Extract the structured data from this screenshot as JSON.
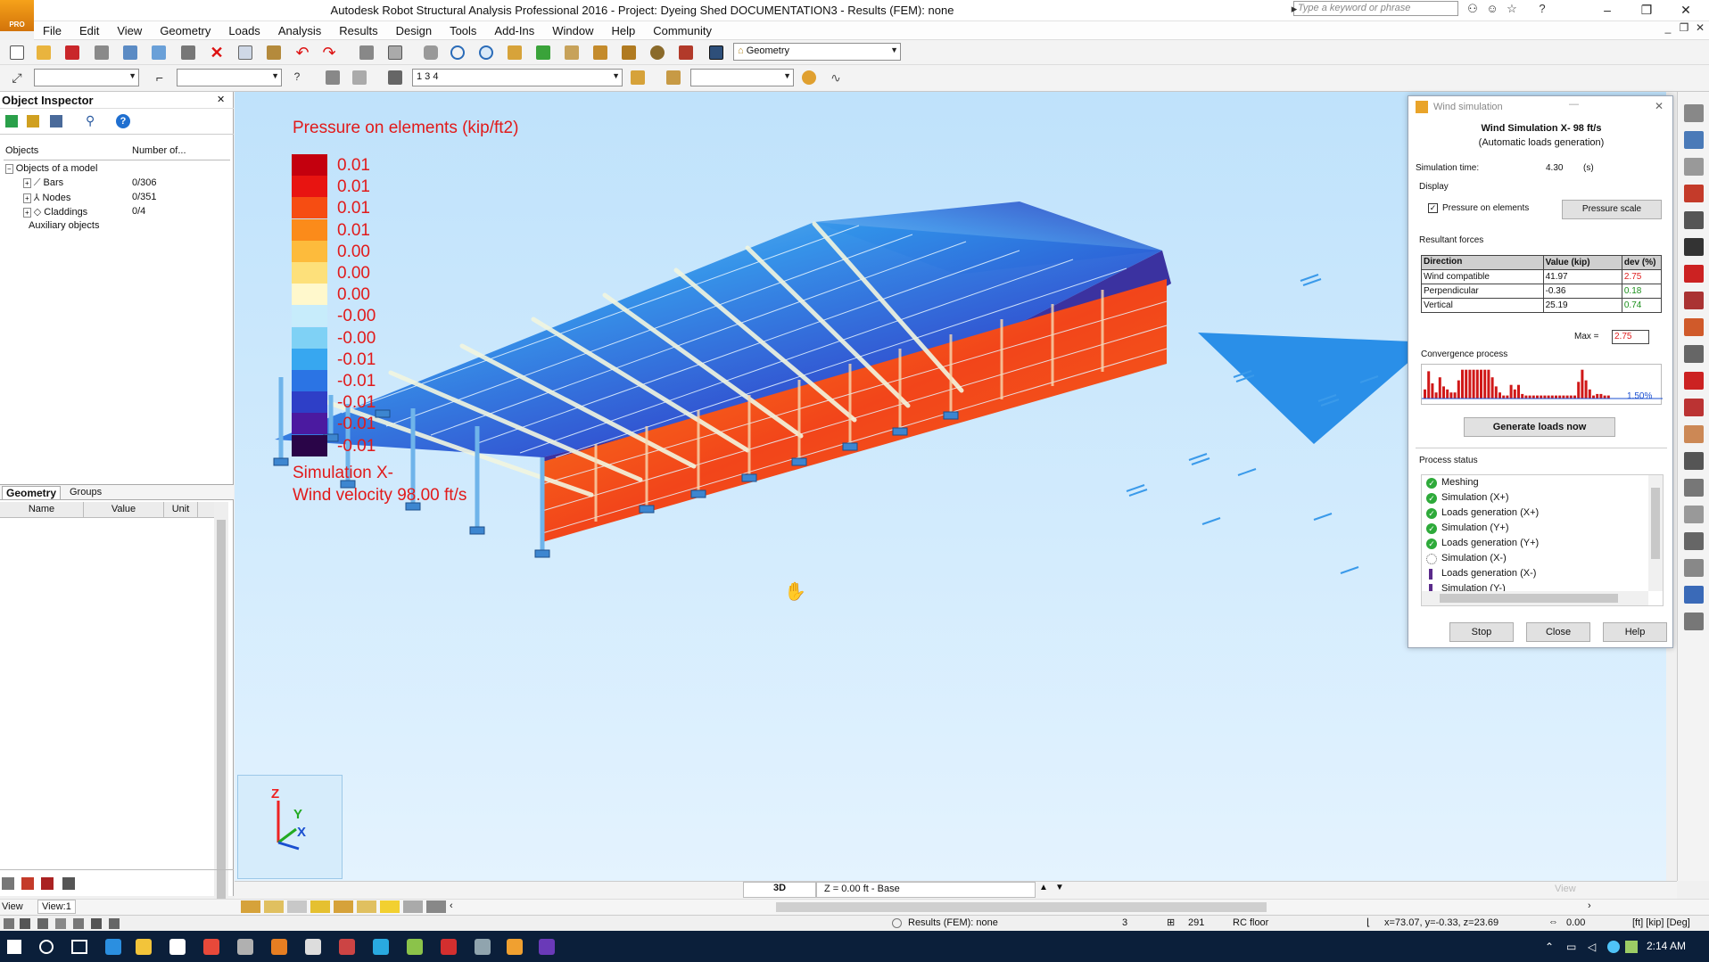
{
  "app": {
    "title": "Autodesk Robot Structural Analysis Professional 2016 - Project: Dyeing Shed DOCUMENTATION3 - Results (FEM): none",
    "logo_text": "PRO",
    "search_placeholder": "Type a keyword or phrase"
  },
  "menu": [
    "File",
    "Edit",
    "View",
    "Geometry",
    "Loads",
    "Analysis",
    "Results",
    "Design",
    "Tools",
    "Add-Ins",
    "Window",
    "Help",
    "Community"
  ],
  "toolbar": {
    "layout_combo": "Geometry",
    "case_combo": "1 3 4"
  },
  "object_inspector": {
    "title": "Object Inspector",
    "col_objects": "Objects",
    "col_number": "Number of...",
    "tree": [
      {
        "label": "Objects of a model",
        "count": ""
      },
      {
        "label": "Bars",
        "count": "0/306"
      },
      {
        "label": "Nodes",
        "count": "0/351"
      },
      {
        "label": "Claddings",
        "count": "0/4"
      },
      {
        "label": "Auxiliary objects",
        "count": ""
      }
    ],
    "tabs": [
      "Geometry",
      "Groups"
    ],
    "prop_headers": [
      "Name",
      "Value",
      "Unit"
    ]
  },
  "legend": {
    "title": "Pressure on elements (kip/ft2)",
    "entries": [
      {
        "value": "0.01",
        "color": "#c4000e"
      },
      {
        "value": "0.01",
        "color": "#e81411"
      },
      {
        "value": "0.01",
        "color": "#f64d12"
      },
      {
        "value": "0.01",
        "color": "#fb8b1a"
      },
      {
        "value": "0.00",
        "color": "#fdbb3c"
      },
      {
        "value": "0.00",
        "color": "#fde07a"
      },
      {
        "value": "0.00",
        "color": "#fff8cc"
      },
      {
        "value": "-0.00",
        "color": "#c7ecfb"
      },
      {
        "value": "-0.00",
        "color": "#7fd1f5"
      },
      {
        "value": "-0.01",
        "color": "#37a7f0"
      },
      {
        "value": "-0.01",
        "color": "#2b74e4"
      },
      {
        "value": "-0.01",
        "color": "#2e3fc7"
      },
      {
        "value": "-0.01",
        "color": "#4b1aa0"
      },
      {
        "value": "-0.01",
        "color": "#2a0548"
      }
    ],
    "caption_line1": "Simulation X-",
    "caption_line2": "Wind velocity 98.00 ft/s"
  },
  "axes": {
    "z": "Z",
    "y": "Y",
    "x": "X"
  },
  "wind_dialog": {
    "window_title": "Wind simulation",
    "heading": "Wind Simulation X- 98 ft/s",
    "subheading": "(Automatic loads generation)",
    "sim_time_label": "Simulation time:",
    "sim_time_value": "4.30",
    "sim_time_unit": "(s)",
    "display_label": "Display",
    "pressure_checkbox": "Pressure on elements",
    "pressure_scale_btn": "Pressure scale",
    "resultant_label": "Resultant forces",
    "rf_head": {
      "direction": "Direction",
      "value": "Value (kip)",
      "dev": "dev (%)"
    },
    "rf_rows": [
      {
        "direction": "Wind compatible",
        "value": "41.97",
        "dev": "2.75",
        "dev_color": "#e02020"
      },
      {
        "direction": "Perpendicular",
        "value": "-0.36",
        "dev": "0.18",
        "dev_color": "#1a8f1a"
      },
      {
        "direction": "Vertical",
        "value": "25.19",
        "dev": "0.74",
        "dev_color": "#1a8f1a"
      }
    ],
    "max_label": "Max =",
    "max_value": "2.75",
    "convergence_label": "Convergence process",
    "convergence_value": "1.50%",
    "convergence_bars": [
      0.3,
      0.9,
      0.5,
      0.2,
      0.7,
      0.4,
      0.3,
      0.2,
      0.2,
      0.6,
      0.95,
      0.95,
      0.95,
      0.95,
      0.95,
      0.95,
      0.95,
      0.95,
      0.7,
      0.4,
      0.2,
      0.1,
      0.1,
      0.45,
      0.3,
      0.45,
      0.15,
      0.1,
      0.1,
      0.1,
      0.1,
      0.1,
      0.1,
      0.1,
      0.1,
      0.1,
      0.1,
      0.1,
      0.1,
      0.1,
      0.1,
      0.55,
      0.95,
      0.6,
      0.3,
      0.1,
      0.15,
      0.15,
      0.1,
      0.1
    ],
    "generate_btn": "Generate loads now",
    "process_label": "Process status",
    "process_rows": [
      {
        "label": "Meshing",
        "state": "done"
      },
      {
        "label": "Simulation (X+)",
        "state": "done"
      },
      {
        "label": "Loads generation (X+)",
        "state": "done"
      },
      {
        "label": "Simulation (Y+)",
        "state": "done"
      },
      {
        "label": "Loads generation (Y+)",
        "state": "done"
      },
      {
        "label": "Simulation (X-)",
        "state": "running"
      },
      {
        "label": "Loads generation (X-)",
        "state": "pending"
      },
      {
        "label": "Simulation (Y-)",
        "state": "pending"
      }
    ],
    "buttons": [
      "Stop",
      "Close",
      "Help"
    ]
  },
  "view_bar": {
    "mode": "3D",
    "level": "Z = 0.00 ft - Base",
    "view_label": "View"
  },
  "view_tab": {
    "label": "View",
    "value": "View:1"
  },
  "status": {
    "results": "Results (FEM): none",
    "num1": "3",
    "num2": "291",
    "section": "RC floor",
    "coords": "x=73.07, y=-0.33, z=23.69",
    "angle": "0.00",
    "units": "[ft] [kip] [Deg]"
  },
  "taskbar": {
    "time": "2:14 AM"
  }
}
